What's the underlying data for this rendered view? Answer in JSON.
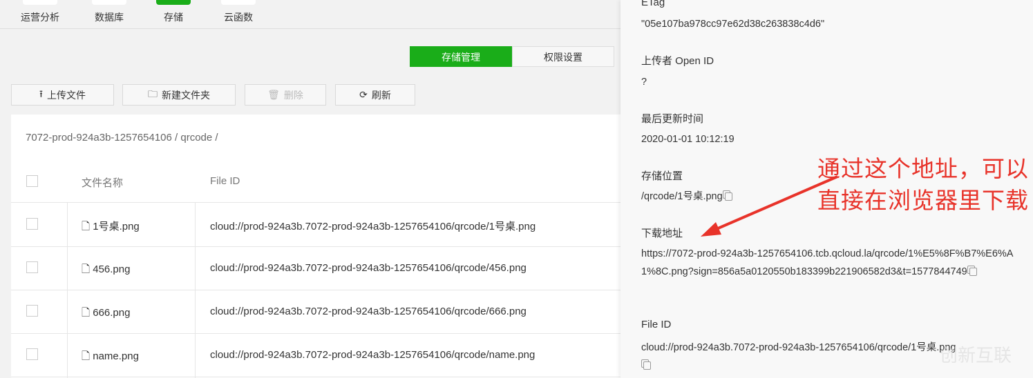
{
  "nav": [
    {
      "label": "运营分析"
    },
    {
      "label": "数据库"
    },
    {
      "label": "存储"
    },
    {
      "label": "云函数"
    }
  ],
  "tabs": {
    "storage": "存储管理",
    "perm": "权限设置"
  },
  "toolbar": {
    "upload": "上传文件",
    "newfolder": "新建文件夹",
    "delete": "删除",
    "refresh": "刷新"
  },
  "breadcrumb": "7072-prod-924a3b-1257654106 / qrcode /",
  "table": {
    "col_name": "文件名称",
    "col_id": "File ID",
    "rows": [
      {
        "name": "1号桌.png",
        "id": "cloud://prod-924a3b.7072-prod-924a3b-1257654106/qrcode/1号桌.png"
      },
      {
        "name": "456.png",
        "id": "cloud://prod-924a3b.7072-prod-924a3b-1257654106/qrcode/456.png"
      },
      {
        "name": "666.png",
        "id": "cloud://prod-924a3b.7072-prod-924a3b-1257654106/qrcode/666.png"
      },
      {
        "name": "name.png",
        "id": "cloud://prod-924a3b.7072-prod-924a3b-1257654106/qrcode/name.png"
      }
    ]
  },
  "detail": {
    "etag_label": "ETag",
    "etag": "\"05e107ba978cc97e62d38c263838c4d6\"",
    "openid_label": "上传者 Open ID",
    "openid": "?",
    "updated_label": "最后更新时间",
    "updated": "2020-01-01 10:12:19",
    "location_label": "存储位置",
    "location": "/qrcode/1号桌.png",
    "download_label": "下载地址",
    "download": "https://7072-prod-924a3b-1257654106.tcb.qcloud.la/qrcode/1%E5%8F%B7%E6%A1%8C.png?sign=856a5a0120550b183399b221906582d3&t=1577844749",
    "fileid_label": "File ID",
    "fileid": "cloud://prod-924a3b.7072-prod-924a3b-1257654106/qrcode/1号桌.png"
  },
  "annotation": {
    "line1": "通过这个地址，可以",
    "line2": "直接在浏览器里下载"
  },
  "watermark": "创新互联",
  "colors": {
    "accent": "#1aad19",
    "annotation": "#e8332a"
  }
}
